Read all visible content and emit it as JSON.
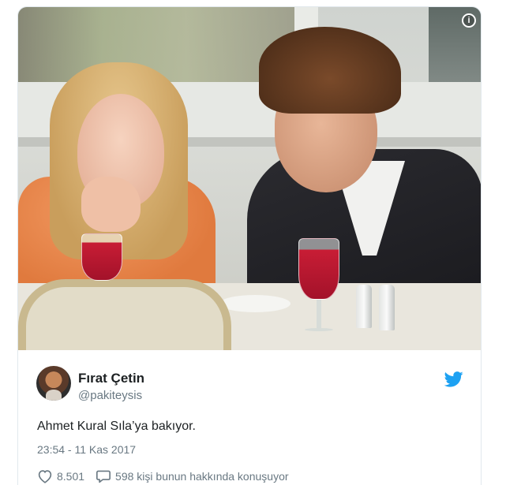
{
  "tweet": {
    "author_name": "Fırat Çetin",
    "author_handle": "@pakiteysis",
    "text": "Ahmet Kural Sıla’ya bakıyor.",
    "timestamp": "23:54 - 11 Kas 2017",
    "likes": "8.501",
    "conversation": "598 kişi bunun hakkında konuşuyor"
  },
  "colors": {
    "twitter_blue": "#1da1f2",
    "text_primary": "#1c2022",
    "text_secondary": "#697882"
  },
  "icons": {
    "info": "info-icon",
    "brand": "twitter-bird-icon",
    "like": "heart-icon",
    "reply": "speech-bubble-icon"
  }
}
